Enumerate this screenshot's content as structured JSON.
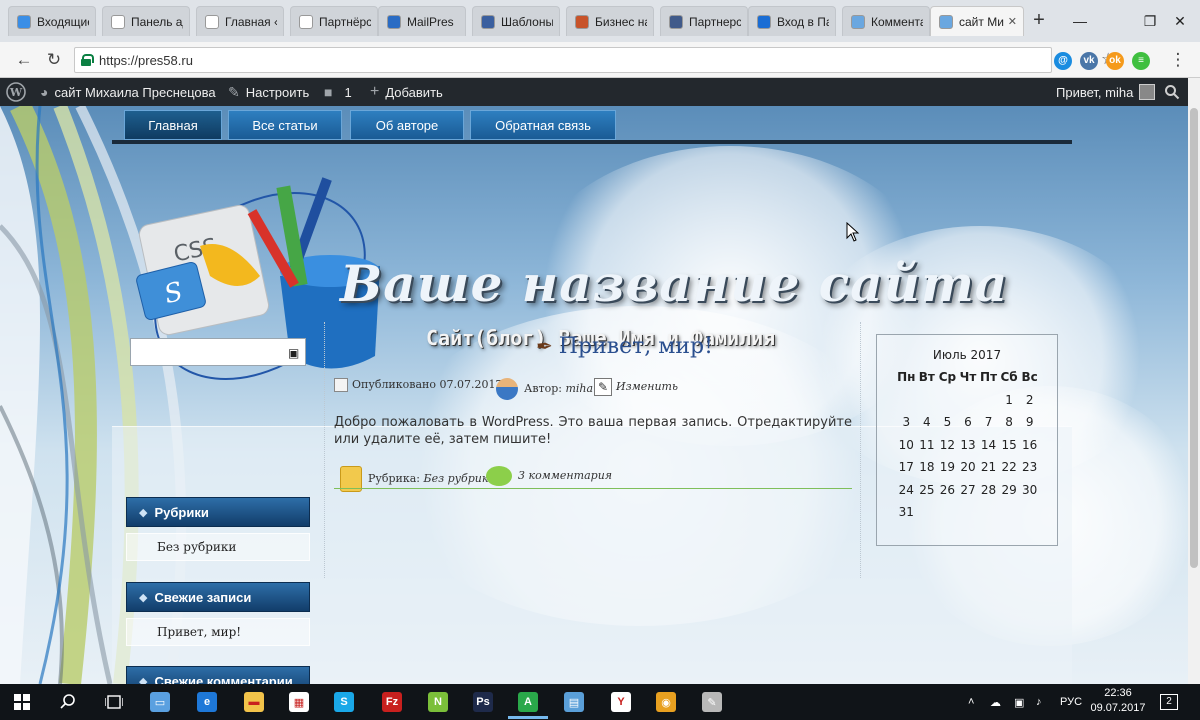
{
  "browser": {
    "tabs": [
      {
        "label": "Входящие",
        "color": "#3a8ee6"
      },
      {
        "label": "Панель ад",
        "color": "#ffffff"
      },
      {
        "label": "Главная ‹",
        "color": "#ffffff"
      },
      {
        "label": "Партнёрс",
        "color": "#ffffff"
      },
      {
        "label": "MailPres",
        "color": "#2a6cc4"
      },
      {
        "label": "Шаблоны",
        "color": "#3a5f9f"
      },
      {
        "label": "Бизнес на",
        "color": "#c8532a"
      },
      {
        "label": "Партнерс",
        "color": "#405a8a"
      },
      {
        "label": "Вход в Па",
        "color": "#1a6dd4"
      },
      {
        "label": "Коммента",
        "color": "#6aa7e0"
      },
      {
        "label": "сайт Миха",
        "color": "#6aa7e0"
      }
    ],
    "active_tab_index": 10,
    "new_tab_label": "+",
    "url": "https://pres58.ru",
    "extensions": [
      {
        "name": "ext-mail-icon",
        "label": "@",
        "color": "#1a8ce0"
      },
      {
        "name": "ext-vk-icon",
        "label": "vk",
        "color": "#4a76a8"
      },
      {
        "name": "ext-ok-icon",
        "label": "ok",
        "color": "#f59a1b"
      },
      {
        "name": "ext-green-icon",
        "label": "≡",
        "color": "#3fbf3f"
      }
    ]
  },
  "wp_admin_bar": {
    "site_name": "сайт Михаила Преснецова",
    "customize": "Настроить",
    "comments_count": "1",
    "add_new": "Добавить",
    "greeting": "Привет, miha"
  },
  "site": {
    "nav": [
      "Главная",
      "Все статьи",
      "Об авторе",
      "Обратная связь"
    ],
    "title": "Ваше название сайта",
    "subtitle": "Сайт(блог) Ваше Имя и Фамилия",
    "logo_text": "CSS",
    "logo_letter": "S"
  },
  "sidebar": {
    "widgets": [
      {
        "title": "Рубрики",
        "items": [
          "Без рубрики"
        ]
      },
      {
        "title": "Свежие записи",
        "items": [
          "Привет, мир!"
        ]
      },
      {
        "title": "Свежие комментарии",
        "items": []
      }
    ]
  },
  "post": {
    "title": "Привет, мир!",
    "published": "Опубликовано 07.07.2017",
    "author_label": "Автор:",
    "author": "miha",
    "edit": "Изменить",
    "body": "Добро пожаловать в WordPress. Это ваша первая запись. Отредактируйте или удалите её, затем пишите!",
    "category_label": "Рубрика:",
    "category": "Без рубрики",
    "comments": "3 комментария"
  },
  "calendar": {
    "title": "Июль 2017",
    "days": [
      "Пн",
      "Вт",
      "Ср",
      "Чт",
      "Пт",
      "Сб",
      "Вс"
    ],
    "weeks": [
      [
        "",
        "",
        "",
        "",
        "",
        "1",
        "2"
      ],
      [
        "3",
        "4",
        "5",
        "6",
        "7",
        "8",
        "9"
      ],
      [
        "10",
        "11",
        "12",
        "13",
        "14",
        "15",
        "16"
      ],
      [
        "17",
        "18",
        "19",
        "20",
        "21",
        "22",
        "23"
      ],
      [
        "24",
        "25",
        "26",
        "27",
        "28",
        "29",
        "30"
      ],
      [
        "31",
        "",
        "",
        "",
        "",
        "",
        ""
      ]
    ]
  },
  "taskbar": {
    "lang": "РУС",
    "time": "22:36",
    "date": "09.07.2017",
    "notification_count": "2"
  }
}
